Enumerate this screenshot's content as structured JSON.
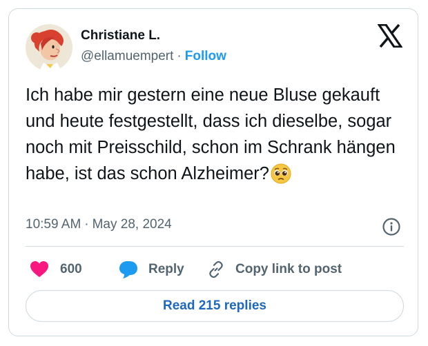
{
  "author": {
    "name": "Christiane L.",
    "handle": "@ellamuempert",
    "separator": "·",
    "follow_label": "Follow"
  },
  "tweet": {
    "text": "Ich habe mir gestern eine neue Bluse gekauft und heute festgestellt, dass ich dieselbe, sogar noch mit Preisschild, schon im Schrank hängen habe, ist das schon Alzheimer?",
    "emoji_name": "pleading-face"
  },
  "meta": {
    "time": "10:59 AM",
    "separator": "·",
    "date": "May 28, 2024"
  },
  "actions": {
    "like_count": "600",
    "reply_label": "Reply",
    "copy_label": "Copy link to post"
  },
  "read_replies_label": "Read 215 replies",
  "colors": {
    "like": "#f91880",
    "reply": "#1d9bf0",
    "link": "#1d9bf0",
    "text": "#0f1419",
    "secondary": "#536471",
    "border": "#cfd9de"
  }
}
